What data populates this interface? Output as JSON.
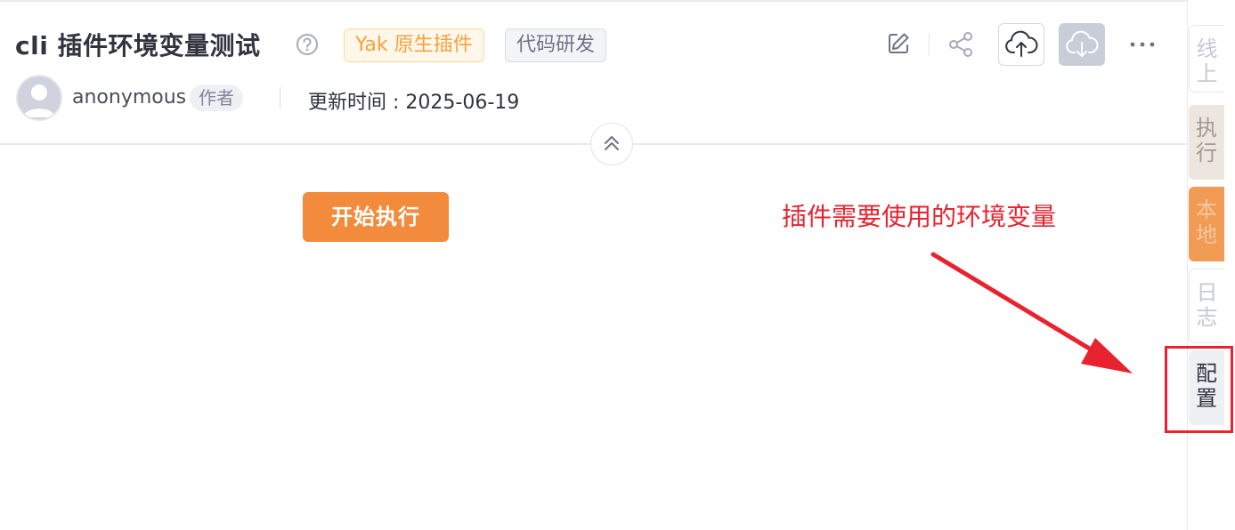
{
  "header": {
    "title": "cli 插件环境变量测试",
    "tags": [
      "Yak 原生插件",
      "代码研发"
    ],
    "author": {
      "name": "anonymous",
      "badge": "作者"
    },
    "update_time": "更新时间 : 2025-06-19"
  },
  "toolbar": {
    "icons": [
      "edit-icon",
      "share-icon",
      "upload-icon",
      "download-icon",
      "more-icon"
    ]
  },
  "main": {
    "start_button_label": "开始执行"
  },
  "annotation": {
    "text": "插件需要使用的环境变量",
    "color": "#e8222e"
  },
  "sidebar": {
    "tabs": [
      {
        "label": "线上",
        "state": "inactive"
      },
      {
        "label": "执行",
        "state": "muted"
      },
      {
        "label": "本地",
        "state": "accent"
      },
      {
        "label": "日志",
        "state": "inactive"
      },
      {
        "label": "配置",
        "state": "active"
      }
    ]
  },
  "colors": {
    "accent": "#f28b3b",
    "tag_yak_text": "#f6a23b",
    "text_primary": "#31343f"
  }
}
